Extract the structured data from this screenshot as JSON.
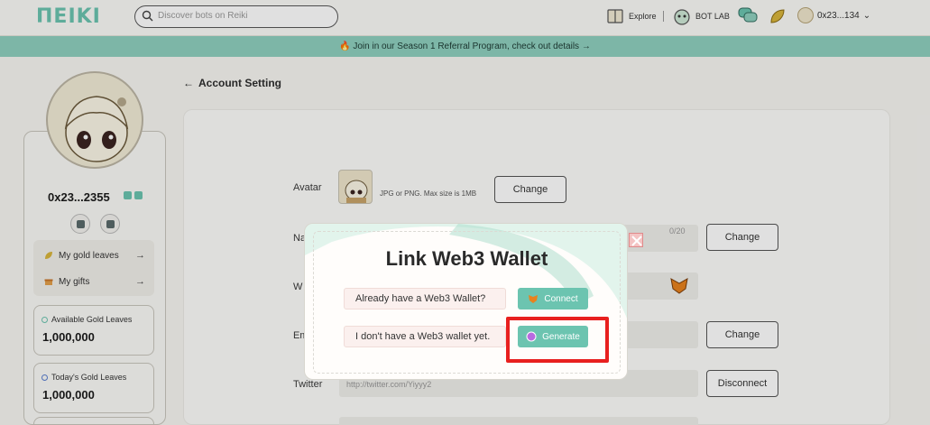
{
  "brand": {
    "logo": "ΠEIKI",
    "accent": "#6cc4b0"
  },
  "search": {
    "placeholder": "Discover bots on Reiki"
  },
  "nav": {
    "explore": "Explore",
    "botlab": "BOT LAB",
    "user": "0x23...134"
  },
  "banner": {
    "text": "🔥 Join in our Season 1 Referral Program, check out details →"
  },
  "sidebar": {
    "username": "0x23...2355",
    "menu": [
      {
        "label": "My gold leaves",
        "icon": "leaf-icon"
      },
      {
        "label": "My gifts",
        "icon": "gift-icon"
      }
    ],
    "cards": [
      {
        "label": "Available Gold Leaves",
        "value": "1,000,000"
      },
      {
        "label": "Today's Gold Leaves",
        "value": "1,000,000"
      }
    ]
  },
  "page": {
    "back_label": "Account Setting",
    "avatar_label": "Avatar",
    "avatar_hint": "JPG or PNG. Max size is  1MB",
    "change": "Change",
    "name_label": "Na",
    "name_counter": "0/20",
    "wallet_label": "W",
    "email_label": "Em",
    "twitter_label": "Twitter",
    "twitter_value": "http://twitter.com/Yiyyy2",
    "disconnect": "Disconnect"
  },
  "modal": {
    "title": "Link Web3 Wallet",
    "have_wallet": "Already have a Web3 Wallet?",
    "connect": "Connect",
    "no_wallet": "I don't have a Web3 wallet yet.",
    "generate": "Generate"
  }
}
